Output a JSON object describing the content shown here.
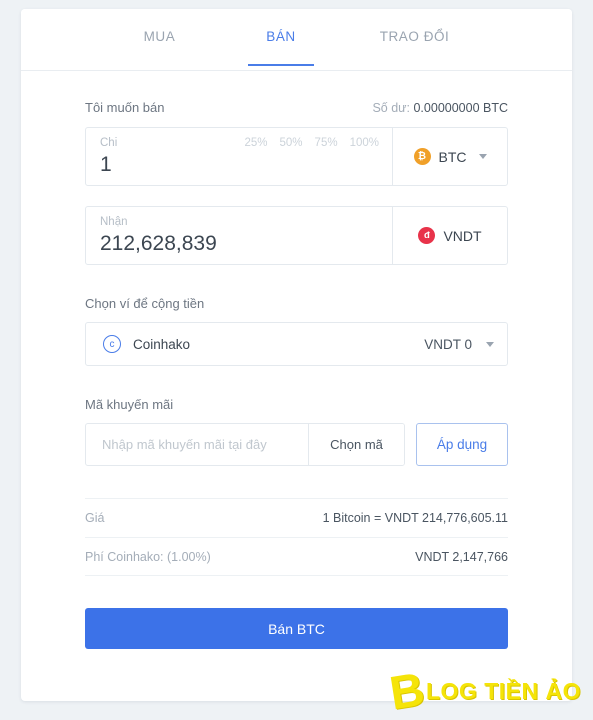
{
  "tabs": [
    {
      "label": "MUA",
      "active": false
    },
    {
      "label": "BÁN",
      "active": true
    },
    {
      "label": "TRAO ĐỔI",
      "active": false
    }
  ],
  "sell": {
    "section_label": "Tôi muốn bán",
    "balance_label": "Số dư:",
    "balance_value": "0.00000000 BTC",
    "spend": {
      "caption": "Chi",
      "value": "1",
      "percents": [
        "25%",
        "50%",
        "75%",
        "100%"
      ],
      "currency": "BTC",
      "currency_icon": "bitcoin-icon",
      "currency_icon_glyph": "₿",
      "currency_color": "#f0a029",
      "has_dropdown": true
    },
    "receive": {
      "caption": "Nhận",
      "value": "212,628,839",
      "currency": "VNDT",
      "currency_icon": "vndt-icon",
      "currency_icon_glyph": "đ",
      "currency_color": "#e8334a",
      "has_dropdown": false
    }
  },
  "wallet": {
    "title": "Chọn ví để cộng tiền",
    "icon": "coinhako-icon",
    "icon_glyph": "c",
    "name": "Coinhako",
    "balance": "VNDT 0"
  },
  "promo": {
    "title": "Mã khuyến mãi",
    "placeholder": "Nhập mã khuyến mãi tại đây",
    "value": "",
    "pick_label": "Chọn mã",
    "apply_label": "Áp dụng"
  },
  "summary": [
    {
      "key": "Giá",
      "value": "1 Bitcoin = VNDT 214,776,605.11"
    },
    {
      "key": "Phí Coinhako: (1.00%)",
      "value": "VNDT 2,147,766"
    }
  ],
  "cta": {
    "label": "Bán BTC"
  },
  "watermark": {
    "mark": "B",
    "text": "LOG TIỀN ẢO",
    "color": "#f5e409"
  },
  "theme": {
    "accent": "#4a7de8",
    "cta": "#3c72e8",
    "page_bg": "#eef2f5"
  }
}
